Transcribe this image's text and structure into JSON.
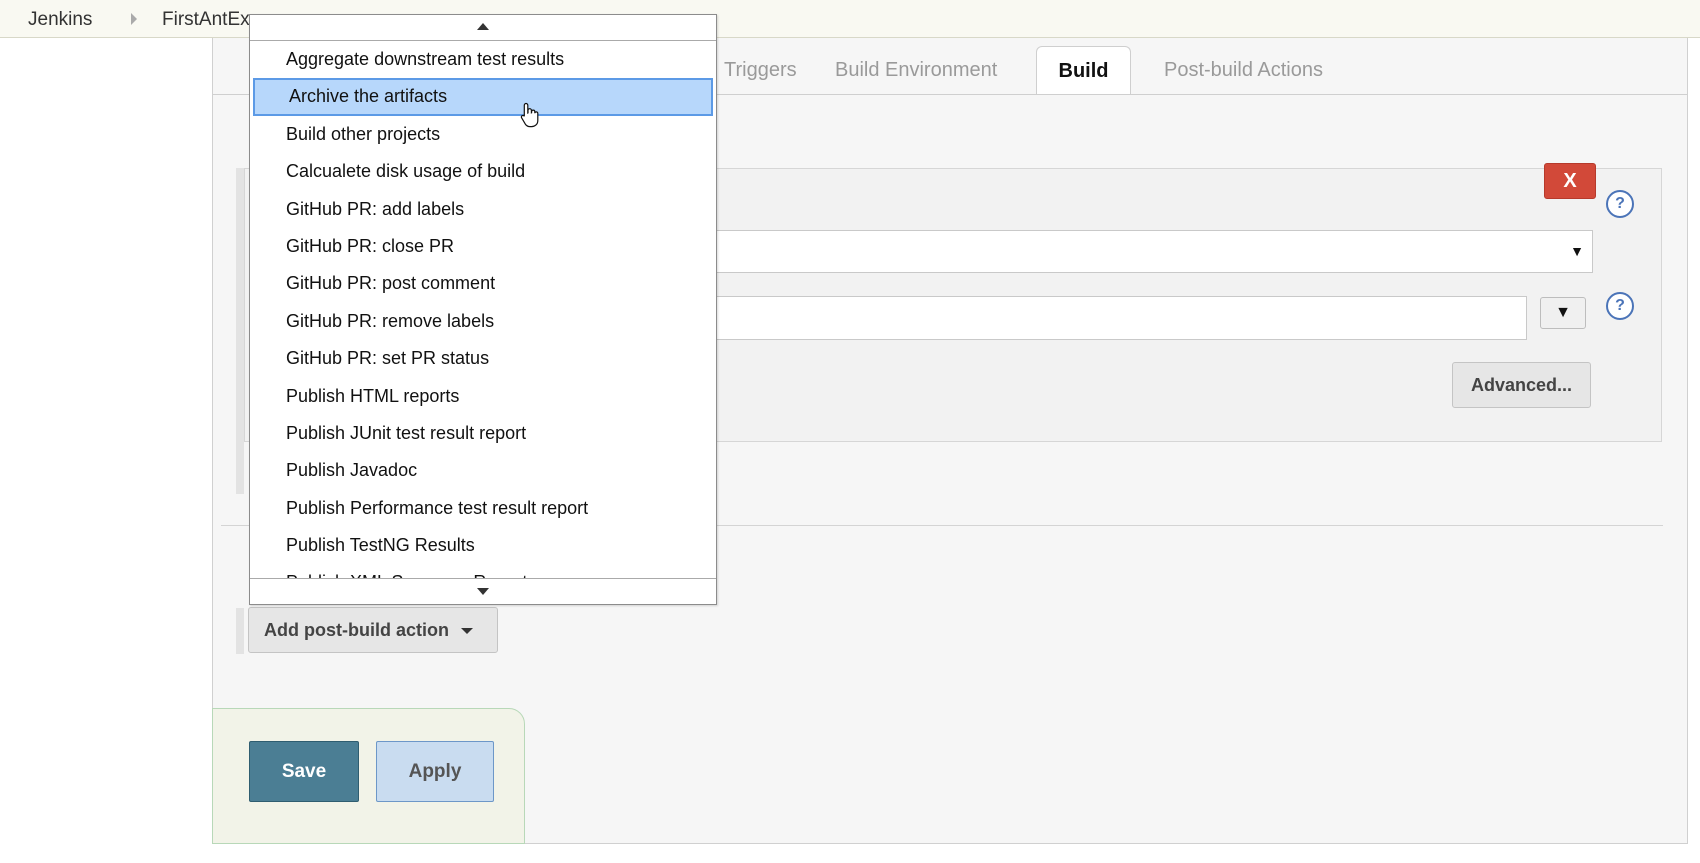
{
  "breadcrumb": {
    "items": [
      "Jenkins",
      "FirstAntEx"
    ]
  },
  "tabs": [
    {
      "label": "Triggers",
      "active": false
    },
    {
      "label": "Build Environment",
      "active": false
    },
    {
      "label": "Build",
      "active": true
    },
    {
      "label": "Post-build Actions",
      "active": false
    }
  ],
  "build_step": {
    "delete_label": "X",
    "help_label": "?",
    "variable_button": "▼",
    "advanced_label": "Advanced..."
  },
  "post_build": {
    "add_action_label": "Add post-build action"
  },
  "actions": {
    "save_label": "Save",
    "apply_label": "Apply"
  },
  "dropdown": {
    "items": [
      "Aggregate downstream test results",
      "Archive the artifacts",
      "Build other projects",
      "Calcualete disk usage of build",
      "GitHub PR: add labels",
      "GitHub PR: close PR",
      "GitHub PR: post comment",
      "GitHub PR: remove labels",
      "GitHub PR: set PR status",
      "Publish HTML reports",
      "Publish JUnit test result report",
      "Publish Javadoc",
      "Publish Performance test result report",
      "Publish TestNG Results",
      "Publish XML Summary Reports"
    ],
    "highlighted_index": 1
  },
  "colors": {
    "accent": "#4b7e94",
    "delete": "#d24939",
    "highlight": "#b7d7fb"
  }
}
